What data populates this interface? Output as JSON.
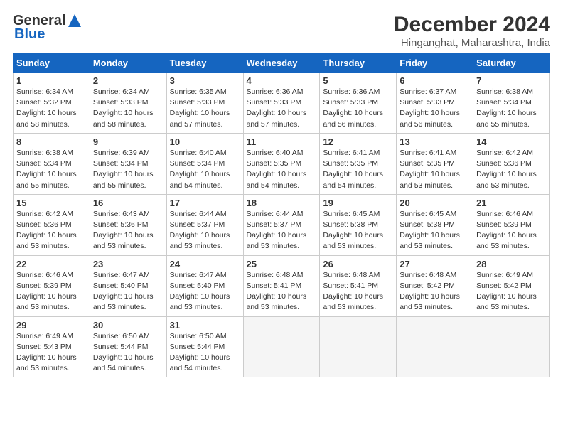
{
  "logo": {
    "line1": "General",
    "line2": "Blue"
  },
  "title": "December 2024",
  "subtitle": "Hinganghat, Maharashtra, India",
  "weekdays": [
    "Sunday",
    "Monday",
    "Tuesday",
    "Wednesday",
    "Thursday",
    "Friday",
    "Saturday"
  ],
  "weeks": [
    [
      {
        "day": 1,
        "sunrise": "6:34 AM",
        "sunset": "5:32 PM",
        "daylight": "10 hours and 58 minutes."
      },
      {
        "day": 2,
        "sunrise": "6:34 AM",
        "sunset": "5:33 PM",
        "daylight": "10 hours and 58 minutes."
      },
      {
        "day": 3,
        "sunrise": "6:35 AM",
        "sunset": "5:33 PM",
        "daylight": "10 hours and 57 minutes."
      },
      {
        "day": 4,
        "sunrise": "6:36 AM",
        "sunset": "5:33 PM",
        "daylight": "10 hours and 57 minutes."
      },
      {
        "day": 5,
        "sunrise": "6:36 AM",
        "sunset": "5:33 PM",
        "daylight": "10 hours and 56 minutes."
      },
      {
        "day": 6,
        "sunrise": "6:37 AM",
        "sunset": "5:33 PM",
        "daylight": "10 hours and 56 minutes."
      },
      {
        "day": 7,
        "sunrise": "6:38 AM",
        "sunset": "5:34 PM",
        "daylight": "10 hours and 55 minutes."
      }
    ],
    [
      {
        "day": 8,
        "sunrise": "6:38 AM",
        "sunset": "5:34 PM",
        "daylight": "10 hours and 55 minutes."
      },
      {
        "day": 9,
        "sunrise": "6:39 AM",
        "sunset": "5:34 PM",
        "daylight": "10 hours and 55 minutes."
      },
      {
        "day": 10,
        "sunrise": "6:40 AM",
        "sunset": "5:34 PM",
        "daylight": "10 hours and 54 minutes."
      },
      {
        "day": 11,
        "sunrise": "6:40 AM",
        "sunset": "5:35 PM",
        "daylight": "10 hours and 54 minutes."
      },
      {
        "day": 12,
        "sunrise": "6:41 AM",
        "sunset": "5:35 PM",
        "daylight": "10 hours and 54 minutes."
      },
      {
        "day": 13,
        "sunrise": "6:41 AM",
        "sunset": "5:35 PM",
        "daylight": "10 hours and 53 minutes."
      },
      {
        "day": 14,
        "sunrise": "6:42 AM",
        "sunset": "5:36 PM",
        "daylight": "10 hours and 53 minutes."
      }
    ],
    [
      {
        "day": 15,
        "sunrise": "6:42 AM",
        "sunset": "5:36 PM",
        "daylight": "10 hours and 53 minutes."
      },
      {
        "day": 16,
        "sunrise": "6:43 AM",
        "sunset": "5:36 PM",
        "daylight": "10 hours and 53 minutes."
      },
      {
        "day": 17,
        "sunrise": "6:44 AM",
        "sunset": "5:37 PM",
        "daylight": "10 hours and 53 minutes."
      },
      {
        "day": 18,
        "sunrise": "6:44 AM",
        "sunset": "5:37 PM",
        "daylight": "10 hours and 53 minutes."
      },
      {
        "day": 19,
        "sunrise": "6:45 AM",
        "sunset": "5:38 PM",
        "daylight": "10 hours and 53 minutes."
      },
      {
        "day": 20,
        "sunrise": "6:45 AM",
        "sunset": "5:38 PM",
        "daylight": "10 hours and 53 minutes."
      },
      {
        "day": 21,
        "sunrise": "6:46 AM",
        "sunset": "5:39 PM",
        "daylight": "10 hours and 53 minutes."
      }
    ],
    [
      {
        "day": 22,
        "sunrise": "6:46 AM",
        "sunset": "5:39 PM",
        "daylight": "10 hours and 53 minutes."
      },
      {
        "day": 23,
        "sunrise": "6:47 AM",
        "sunset": "5:40 PM",
        "daylight": "10 hours and 53 minutes."
      },
      {
        "day": 24,
        "sunrise": "6:47 AM",
        "sunset": "5:40 PM",
        "daylight": "10 hours and 53 minutes."
      },
      {
        "day": 25,
        "sunrise": "6:48 AM",
        "sunset": "5:41 PM",
        "daylight": "10 hours and 53 minutes."
      },
      {
        "day": 26,
        "sunrise": "6:48 AM",
        "sunset": "5:41 PM",
        "daylight": "10 hours and 53 minutes."
      },
      {
        "day": 27,
        "sunrise": "6:48 AM",
        "sunset": "5:42 PM",
        "daylight": "10 hours and 53 minutes."
      },
      {
        "day": 28,
        "sunrise": "6:49 AM",
        "sunset": "5:42 PM",
        "daylight": "10 hours and 53 minutes."
      }
    ],
    [
      {
        "day": 29,
        "sunrise": "6:49 AM",
        "sunset": "5:43 PM",
        "daylight": "10 hours and 53 minutes."
      },
      {
        "day": 30,
        "sunrise": "6:50 AM",
        "sunset": "5:44 PM",
        "daylight": "10 hours and 54 minutes."
      },
      {
        "day": 31,
        "sunrise": "6:50 AM",
        "sunset": "5:44 PM",
        "daylight": "10 hours and 54 minutes."
      },
      null,
      null,
      null,
      null
    ]
  ]
}
